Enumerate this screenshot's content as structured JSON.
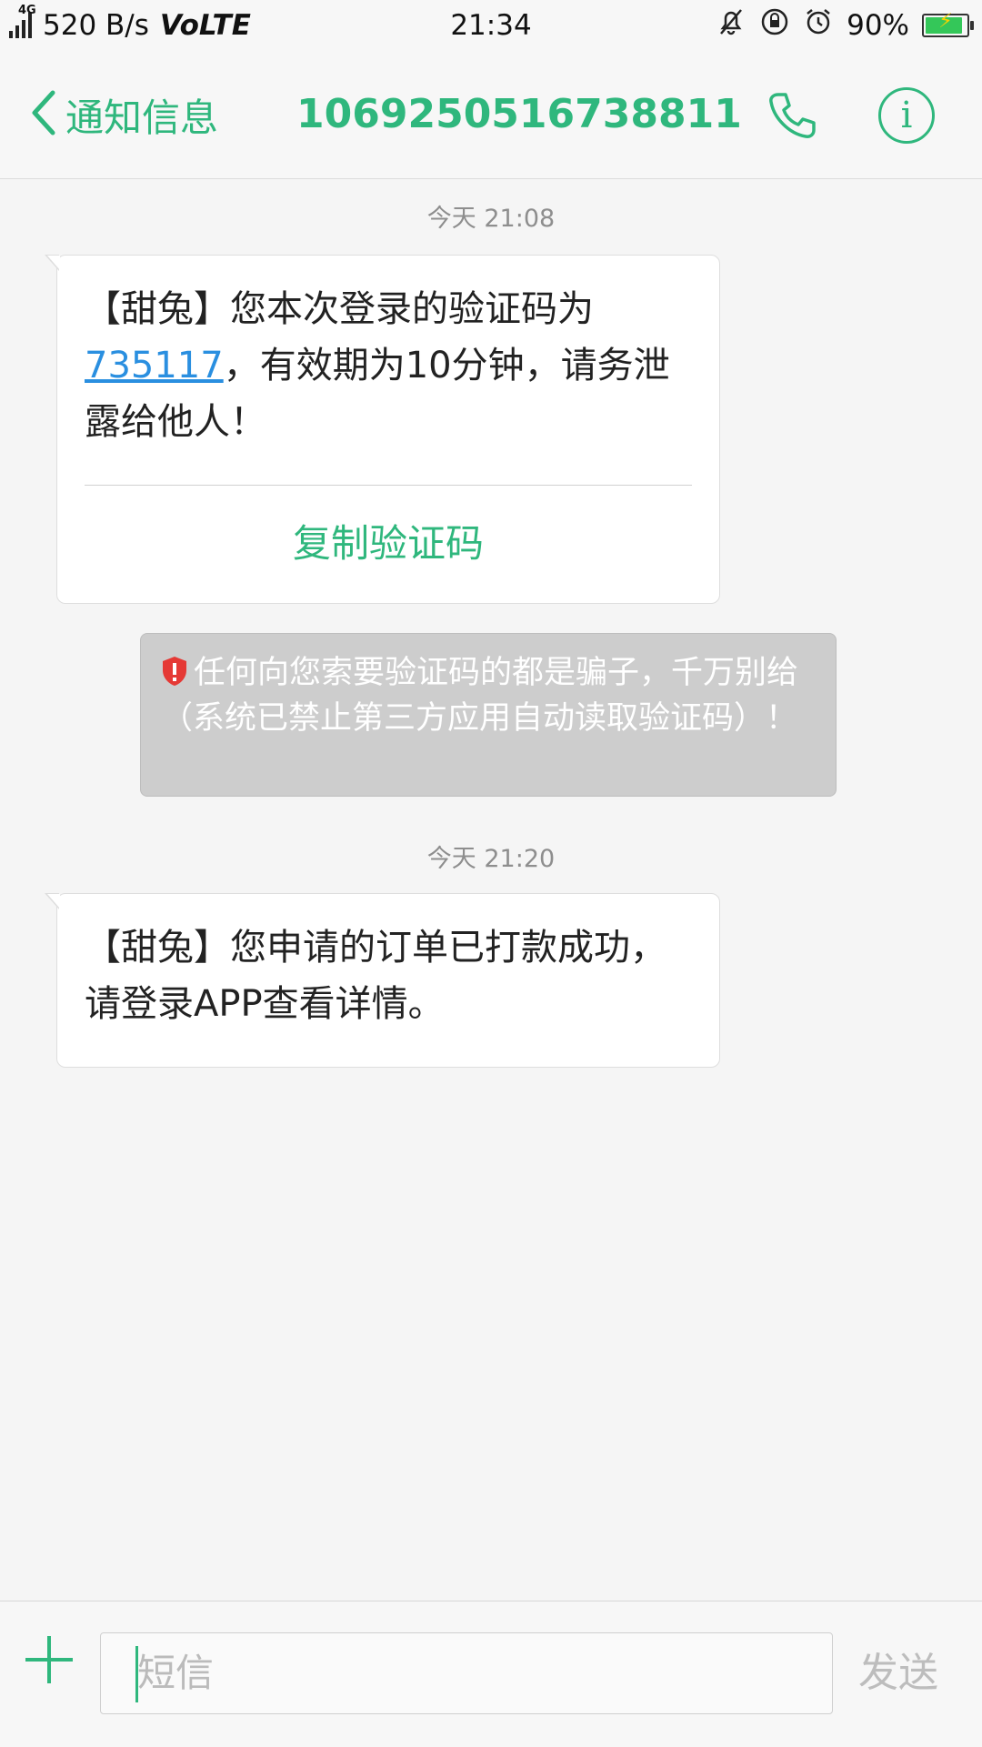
{
  "status_bar": {
    "network": "4G",
    "speed": "520 B/s",
    "volte": "VoLTE",
    "time": "21:34",
    "battery": "90%",
    "battery_level": 0.9
  },
  "header": {
    "back_label": "通知信息",
    "title": "1069250516738811"
  },
  "messages": [
    {
      "timestamp": "今天 21:08",
      "text_before_code": "【甜兔】您本次登录的验证码为",
      "code": "735117",
      "text_after_code": "，有效期为10分钟，请务泄露给他人！",
      "copy_label": "复制验证码"
    },
    {
      "timestamp": "今天 21:20",
      "text": "【甜兔】您申请的订单已打款成功，请登录APP查看详情。"
    }
  ],
  "warning": {
    "text": "任何向您索要验证码的都是骗子，千万别给（系统已禁止第三方应用自动读取验证码）！"
  },
  "input_bar": {
    "placeholder": "短信",
    "send_label": "发送"
  },
  "colors": {
    "accent": "#2fb77d",
    "link": "#2a8fe0",
    "warning_bg": "#cdcdcd"
  }
}
